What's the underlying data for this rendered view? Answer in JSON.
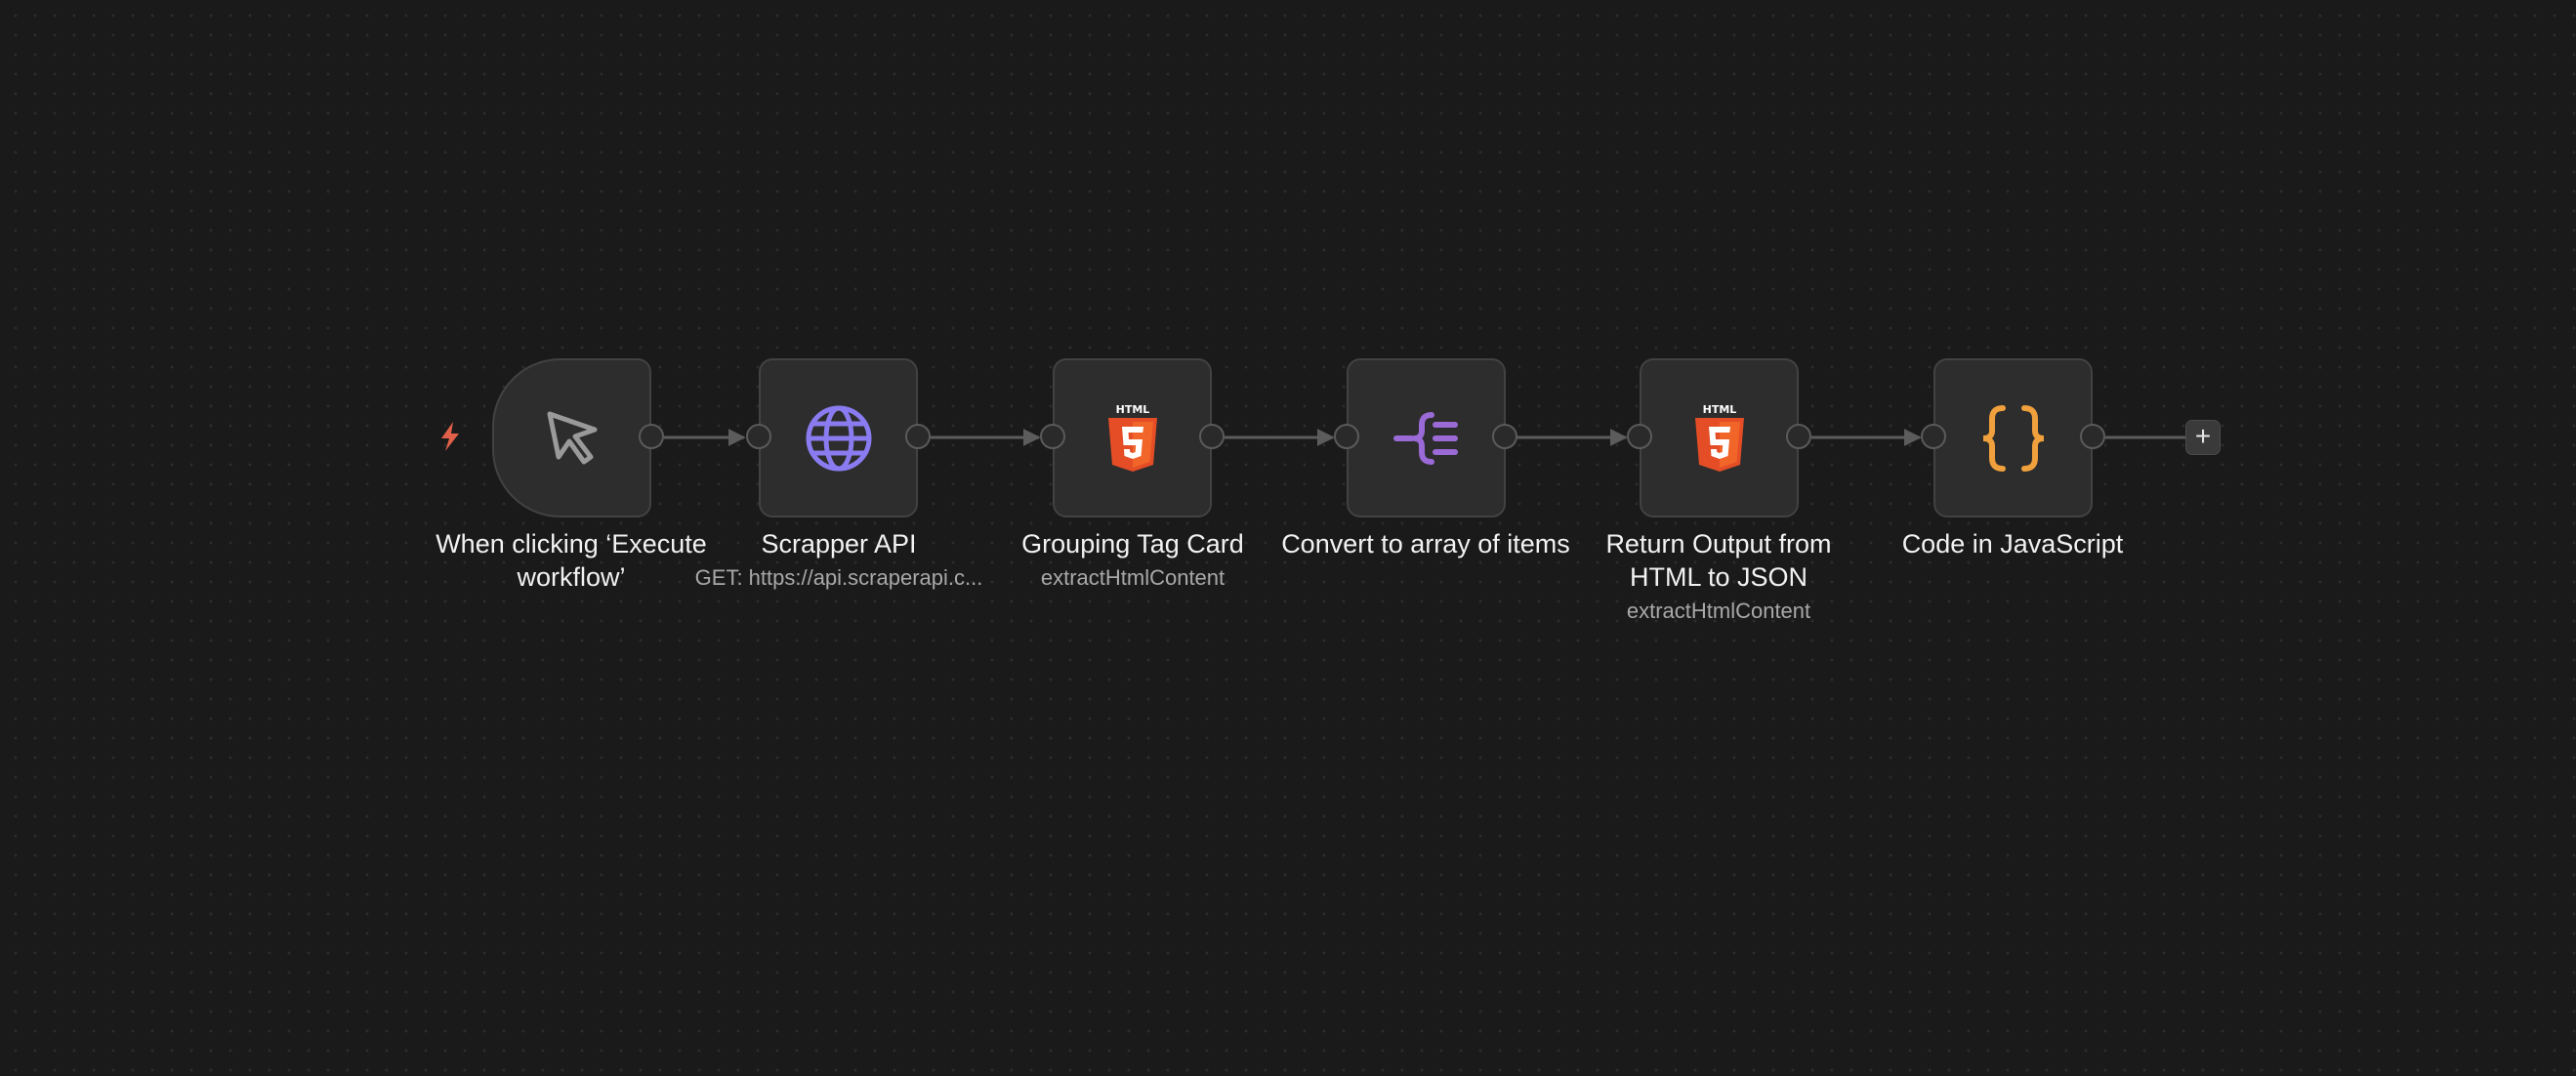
{
  "nodes": [
    {
      "title": "When clicking ‘Execute workflow’",
      "subtitle": "",
      "icon": "cursor-icon"
    },
    {
      "title": "Scrapper API",
      "subtitle": "GET: https://api.scraperapi.c...",
      "icon": "globe-icon"
    },
    {
      "title": "Grouping Tag Card",
      "subtitle": "extractHtmlContent",
      "icon": "html5-icon"
    },
    {
      "title": "Convert to array of items",
      "subtitle": "",
      "icon": "split-out-icon"
    },
    {
      "title": "Return Output from HTML to JSON",
      "subtitle": "extractHtmlContent",
      "icon": "html5-icon"
    },
    {
      "title": "Code in JavaScript",
      "subtitle": "",
      "icon": "braces-icon"
    }
  ],
  "add_button": {
    "label": "+"
  },
  "trigger_icon": "lightning-bolt-icon",
  "colors": {
    "background": "#1a1a1a",
    "node": "#2d2d2d",
    "node_border": "#424242",
    "edge": "#5c5c5c",
    "trigger_bolt": "#e0604a",
    "globe": "#8a7cf0",
    "html5": "#e44d26",
    "split": "#9a6bd6",
    "braces": "#f0a03c"
  }
}
